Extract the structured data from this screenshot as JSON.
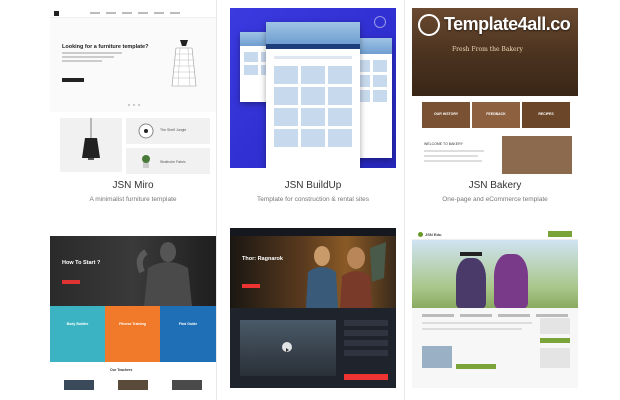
{
  "cards": [
    {
      "title": "JSN Miro",
      "description": "A minimalist furniture template"
    },
    {
      "title": "JSN BuildUp",
      "description": "Template for construction & rental sites"
    },
    {
      "title": "JSN Bakery",
      "description": "One-page and eCommerce template"
    }
  ],
  "miro_preview": {
    "heading": "Looking for a furniture template?",
    "tile_labels": [
      "The Shelf Jungle",
      "Stratholm Fabric"
    ]
  },
  "bakery_preview": {
    "watermark": "Template4all.co",
    "tagline": "Fresh From the Bakery",
    "boxes": [
      "OUR HISTORY",
      "FEEDBACK",
      "RECIPES"
    ],
    "welcome": "WELCOME TO BAKERY"
  },
  "fitness_preview": {
    "heading": "How To Start ?",
    "teachers": "Our Teachers",
    "panels": [
      {
        "label": "Body Builder",
        "color": "#3bb3c3"
      },
      {
        "label": "Fitness Training",
        "color": "#f07a2a"
      },
      {
        "label": "Find Guide",
        "color": "#1e6fb5"
      }
    ]
  },
  "movie_preview": {
    "heading": "Thor: Ragnarok"
  },
  "education_preview": {
    "logo": "JSN Edu"
  },
  "colors": {
    "buildup_bg": "#3333d6",
    "fitness_red": "#d33333",
    "edu_green": "#7aa33a"
  }
}
